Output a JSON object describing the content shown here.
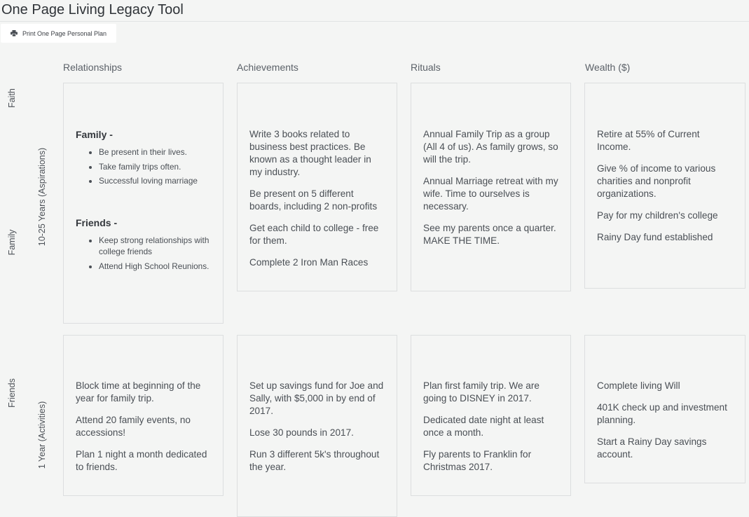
{
  "app": {
    "title": "One Page Living Legacy Tool"
  },
  "toolbar": {
    "print_label": "Print One Page Personal Plan",
    "print_icon": "printer-icon"
  },
  "columns": [
    "Relationships",
    "Achievements",
    "Rituals",
    "Wealth ($)"
  ],
  "side_labels": {
    "faith": "Faith",
    "family": "Family",
    "friends": "Friends"
  },
  "rows": {
    "aspirations": {
      "label": "10-25 Years (Aspirations)"
    },
    "activities": {
      "label": "1 Year (Activities)"
    }
  },
  "cells": {
    "relationships_aspirations": {
      "family_heading": "Family -",
      "family_items": [
        "Be present in their lives.",
        "Take family trips often.",
        "Successful loving marriage"
      ],
      "friends_heading": "Friends -",
      "friends_items": [
        "Keep strong relationships with college friends",
        "Attend High School Reunions."
      ]
    },
    "achievements_aspirations": [
      "Write 3 books related to business best practices. Be known as a thought leader in my industry.",
      "Be present on 5 different boards, including 2 non-profits",
      "Get each child to college - free for them.",
      "Complete 2 Iron Man Races"
    ],
    "rituals_aspirations": [
      "Annual Family Trip as a group (All 4 of us). As family grows, so will the trip.",
      "Annual Marriage retreat with my wife. Time to ourselves is necessary.",
      "See my parents once a quarter. MAKE THE TIME."
    ],
    "wealth_aspirations": [
      "Retire at 55% of Current Income.",
      "Give % of income to various charities and nonprofit organizations.",
      "Pay for my children's college",
      "Rainy Day fund established"
    ],
    "relationships_activities": [
      "Block time at beginning of the year for family trip.",
      "Attend 20 family events, no accessions!",
      "Plan 1 night a month dedicated to friends."
    ],
    "achievements_activities": [
      "Set up savings fund for Joe and Sally, with $5,000 in by end of 2017.",
      "Lose 30 pounds in 2017.",
      "Run 3 different 5k's throughout the year."
    ],
    "rituals_activities": [
      "Plan first family trip. We are going to DISNEY in 2017.",
      "Dedicated date night at least once a month.",
      "Fly parents to Franklin for Christmas 2017."
    ],
    "wealth_activities": [
      "Complete living Will",
      "401K check up and investment planning.",
      "Start a Rainy Day savings account."
    ]
  }
}
